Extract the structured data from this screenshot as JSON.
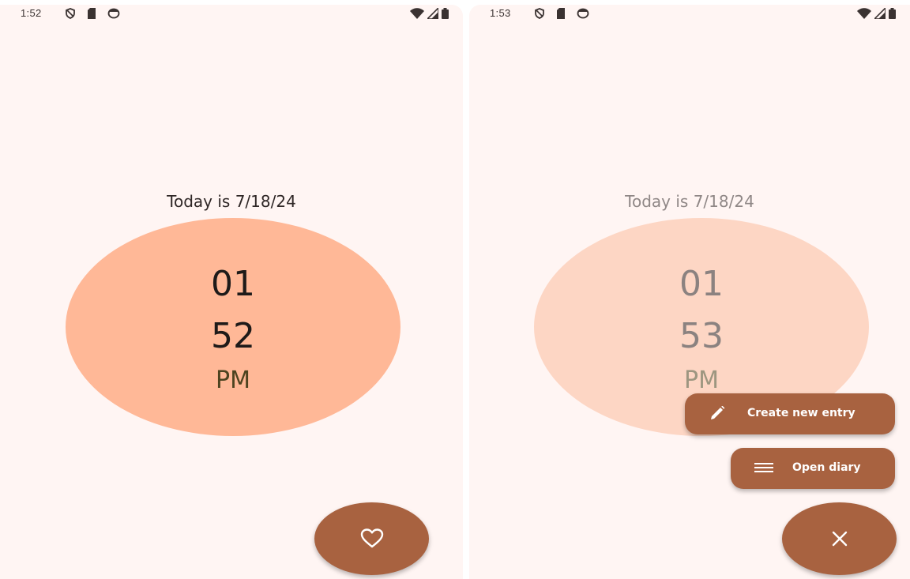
{
  "left_screen": {
    "status": {
      "time": "1:52",
      "left_icons": [
        "vpn-shield-icon",
        "sim-card-icon",
        "data-saver-icon"
      ],
      "right_icons": [
        "wifi-icon",
        "signal-icon",
        "battery-icon"
      ]
    },
    "date_text": "Today is 7/18/24",
    "clock": {
      "hour": "01",
      "minute": "52",
      "ampm": "PM"
    },
    "fab": {
      "icon": "heart-icon"
    }
  },
  "right_screen": {
    "status": {
      "time": "1:53",
      "left_icons": [
        "vpn-shield-icon",
        "sim-card-icon",
        "data-saver-icon"
      ],
      "right_icons": [
        "wifi-icon",
        "signal-icon",
        "battery-icon"
      ]
    },
    "date_text": "Today is 7/18/24",
    "clock": {
      "hour": "01",
      "minute": "53",
      "ampm": "PM"
    },
    "menu": {
      "create_entry_label": "Create new entry",
      "open_diary_label": "Open diary"
    },
    "fab": {
      "icon": "close-icon"
    }
  },
  "colors": {
    "background": "#fff5f3",
    "clock_circle": "#ffb897",
    "clock_circle_dimmed": "#fdd6c4",
    "accent": "#a86240"
  }
}
